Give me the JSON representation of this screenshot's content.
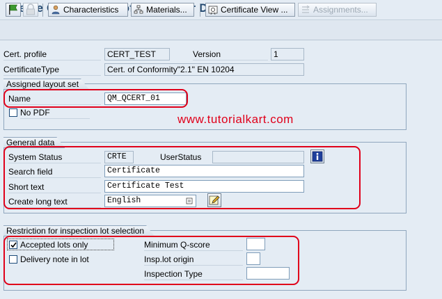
{
  "page_title": "Create Certificate Profile: Header Data",
  "toolbar": {
    "characteristics": "Characteristics",
    "materials": "Materials...",
    "certificate_view": "Certificate View ...",
    "assignments": "Assignments..."
  },
  "header": {
    "cert_profile_label": "Cert. profile",
    "cert_profile_value": "CERT_TEST",
    "version_label": "Version",
    "version_value": "1",
    "cert_type_label": "CertificateType",
    "cert_type_value": "Cert. of Conformity\"2.1\"  EN 10204"
  },
  "layout_set": {
    "title": "Assigned layout set",
    "name_label": "Name",
    "name_value": "QM_QCERT_01",
    "no_pdf_label": "No PDF"
  },
  "watermark": "www.tutorialkart.com",
  "general": {
    "title": "General data",
    "system_status_label": "System Status",
    "system_status_value": "CRTE",
    "user_status_label": "UserStatus",
    "user_status_value": "",
    "search_field_label": "Search field",
    "search_field_value": "Certificate",
    "short_text_label": "Short text",
    "short_text_value": "Certificate Test",
    "long_text_label": "Create long text",
    "long_text_value": "English"
  },
  "restriction": {
    "title": "Restriction for inspection lot selection",
    "accepted_lots_label": "Accepted lots only",
    "accepted_lots_checked": true,
    "delivery_note_label": "Delivery note in lot",
    "delivery_note_checked": false,
    "min_qscore_label": "Minimum Q-score",
    "min_qscore_value": "",
    "insp_lot_origin_label": "Insp.lot origin",
    "insp_lot_origin_value": "",
    "inspection_type_label": "Inspection Type",
    "inspection_type_value": ""
  },
  "colors": {
    "title": "#21476f",
    "highlight": "#e0001a",
    "background": "#e4ecf4"
  }
}
